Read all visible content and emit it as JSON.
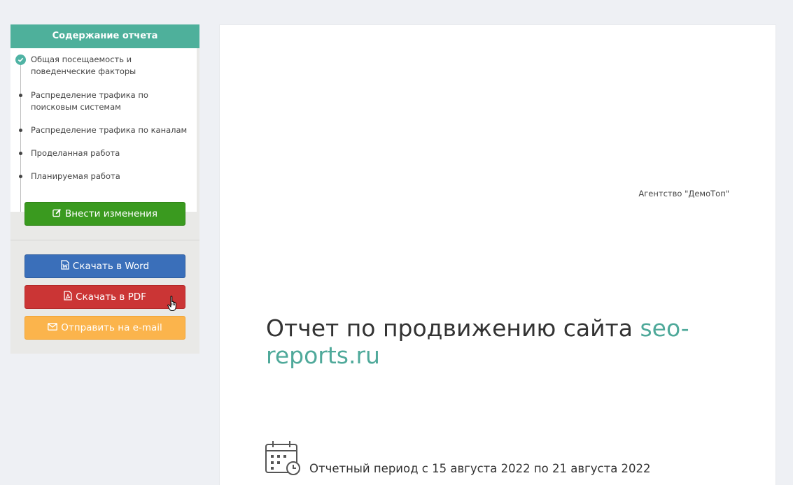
{
  "sidebar": {
    "toc_title": "Содержание отчета",
    "items": [
      {
        "label": "Общая посещаемость и поведенческие факторы",
        "done": true
      },
      {
        "label": "Распределение трафика по поисковым системам",
        "done": false
      },
      {
        "label": "Распределение трафика по каналам",
        "done": false
      },
      {
        "label": "Проделанная работа",
        "done": false
      },
      {
        "label": "Планируемая работа",
        "done": false
      }
    ],
    "edit_label": "Внести изменения",
    "word_label": "Скачать в Word",
    "pdf_label": "Скачать в PDF",
    "mail_label": "Отправить на e-mail"
  },
  "report": {
    "agency": "Агентство \"ДемоТоп\"",
    "title_prefix": "Отчет по продвижению сайта ",
    "site": "seo-reports.ru",
    "period": "Отчетный период с 15 августа 2022 по 21 августа 2022"
  },
  "colors": {
    "accent": "#4eb09b",
    "edit": "#3a9a1f",
    "word": "#3a6fba",
    "pdf": "#cb3535",
    "mail": "#fbb44c"
  }
}
